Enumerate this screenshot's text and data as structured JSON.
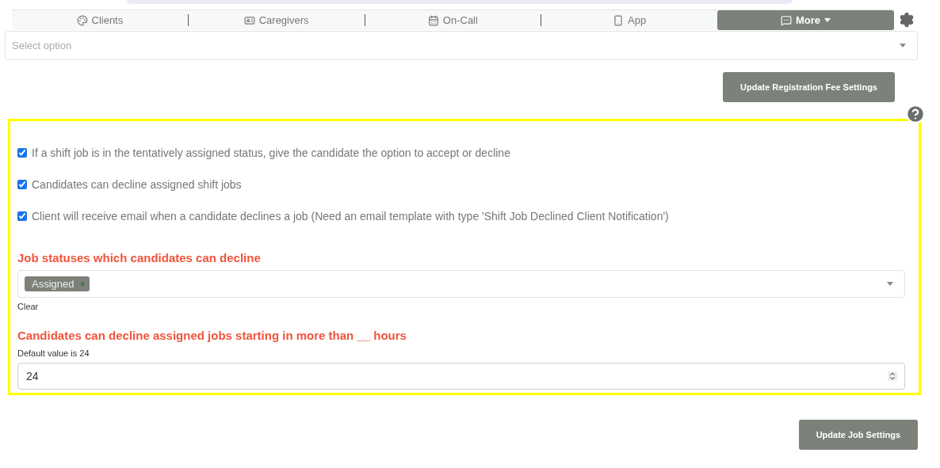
{
  "nav": {
    "tabs": [
      {
        "label": "Clients",
        "selected": false
      },
      {
        "label": "Caregivers",
        "selected": false
      },
      {
        "label": "On-Call",
        "selected": false
      },
      {
        "label": "App",
        "selected": false
      },
      {
        "label": "More",
        "selected": true
      }
    ]
  },
  "select": {
    "placeholder": "Select option"
  },
  "registration_button": "Update Registration Fee Settings",
  "options": [
    {
      "label": "If a shift job is in the tentatively assigned status, give the candidate the option to accept or decline",
      "checked": true
    },
    {
      "label": "Candidates can decline assigned shift jobs",
      "checked": true
    },
    {
      "label": "Client will receive email when a candidate declines a job (Need an email template with type 'Shift Job Declined Client Notification')",
      "checked": true
    }
  ],
  "statuses": {
    "heading": "Job statuses which candidates can decline",
    "tags": [
      {
        "label": "Assigned",
        "remove": "×"
      }
    ],
    "clear": "Clear"
  },
  "hours": {
    "heading": "Candidates can decline assigned jobs starting in more than __ hours",
    "hint": "Default value is 24",
    "value": "24"
  },
  "job_button": "Update Job Settings"
}
